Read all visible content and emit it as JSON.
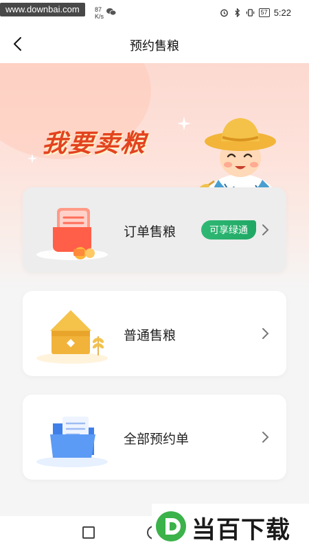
{
  "status_bar": {
    "watermark_url": "www.downbai.com",
    "network_speed": "87\nK/s",
    "time": "5:22",
    "battery": "57",
    "icons": [
      "alarm-icon",
      "bluetooth-icon",
      "vibrate-icon",
      "battery-icon",
      "wechat-icon"
    ]
  },
  "header": {
    "title": "预约售粮"
  },
  "hero": {
    "title": "我要卖粮",
    "illustration": "farmer-with-wheat"
  },
  "cards": [
    {
      "label": "订单售粮",
      "badge": "可享绿通",
      "icon": "order-document-icon"
    },
    {
      "label": "普通售粮",
      "icon": "grain-silo-icon"
    },
    {
      "label": "全部预约单",
      "icon": "folder-icon"
    }
  ],
  "watermark_brand": "当百下载",
  "colors": {
    "hero_title": "#e3431f",
    "badge_green": "#2fb874",
    "card_bg": "#ffffff",
    "page_bg": "#f5f5f5"
  }
}
